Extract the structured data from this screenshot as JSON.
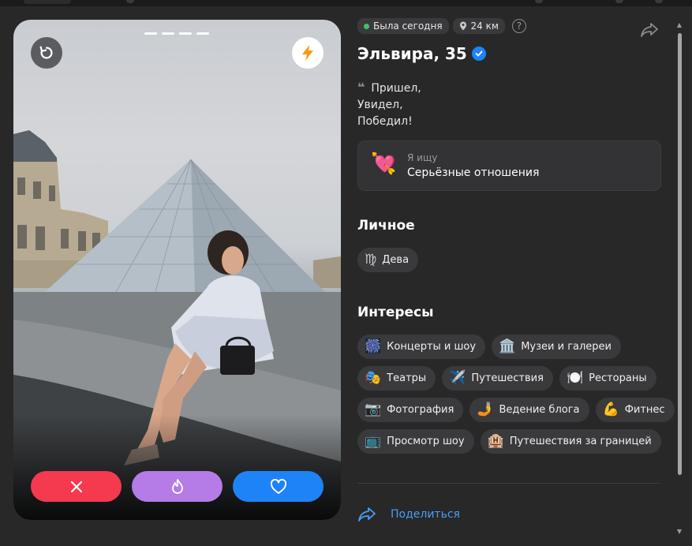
{
  "profile": {
    "status_online": "Была сегодня",
    "distance": "24 км",
    "help": "?",
    "name": "Эльвира, 35",
    "bio_lines": [
      "Пришел,",
      "Увидел,",
      "Победил!"
    ],
    "quote_mark": "❝",
    "seeking": {
      "label": "Я ищу",
      "value": "Серьёзные отношения",
      "emoji": "💘"
    },
    "photos_total": 4
  },
  "sections": {
    "personal_title": "Личное",
    "interests_title": "Интересы"
  },
  "personal": {
    "zodiac_icon": "♍",
    "zodiac": "Дева"
  },
  "interests": [
    {
      "icon": "🎆",
      "label": "Концерты и шоу"
    },
    {
      "icon": "🏛️",
      "label": "Музеи и галереи"
    },
    {
      "icon": "🎭",
      "label": "Театры"
    },
    {
      "icon": "✈️",
      "label": "Путешествия"
    },
    {
      "icon": "🍽️",
      "label": "Рестораны"
    },
    {
      "icon": "📷",
      "label": "Фотография"
    },
    {
      "icon": "🤳",
      "label": "Ведение блога"
    },
    {
      "icon": "💪",
      "label": "Фитнес"
    },
    {
      "icon": "📺",
      "label": "Просмотр шоу"
    },
    {
      "icon": "🏨",
      "label": "Путешествия за границей"
    }
  ],
  "actions": {
    "share_label": "Поделиться"
  },
  "colors": {
    "dislike": "#f5394f",
    "superlike": "#b57be6",
    "like": "#1e83f7",
    "link": "#4a9df8",
    "online": "#3ec46d"
  },
  "icons": {
    "undo": "undo-icon",
    "boost": "lightning-icon",
    "dislike": "close-icon",
    "superlike": "flame-icon",
    "like": "heart-icon",
    "share": "share-arrow-icon",
    "verified": "verified-check-icon",
    "location": "location-pin-icon"
  }
}
